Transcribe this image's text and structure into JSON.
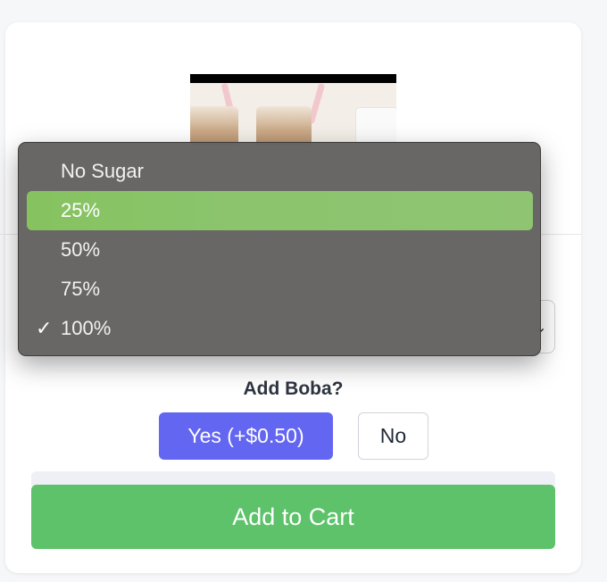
{
  "product": {
    "image_alt": "Boba milk tea cups"
  },
  "sugar_dropdown": {
    "options": [
      "No Sugar",
      "25%",
      "50%",
      "75%",
      "100%"
    ],
    "highlighted": "25%",
    "checked": "100%",
    "checkmark": "✓",
    "chevron": "⌄"
  },
  "boba": {
    "label": "Add Boba?",
    "yes_label": "Yes (+$0.50)",
    "no_label": "No"
  },
  "cart": {
    "button_label": "Add to Cart"
  },
  "colors": {
    "primary": "#6366f1",
    "cart_green": "#5dc26a",
    "highlight_green": "#8bc46d",
    "menu_bg": "#646260"
  }
}
